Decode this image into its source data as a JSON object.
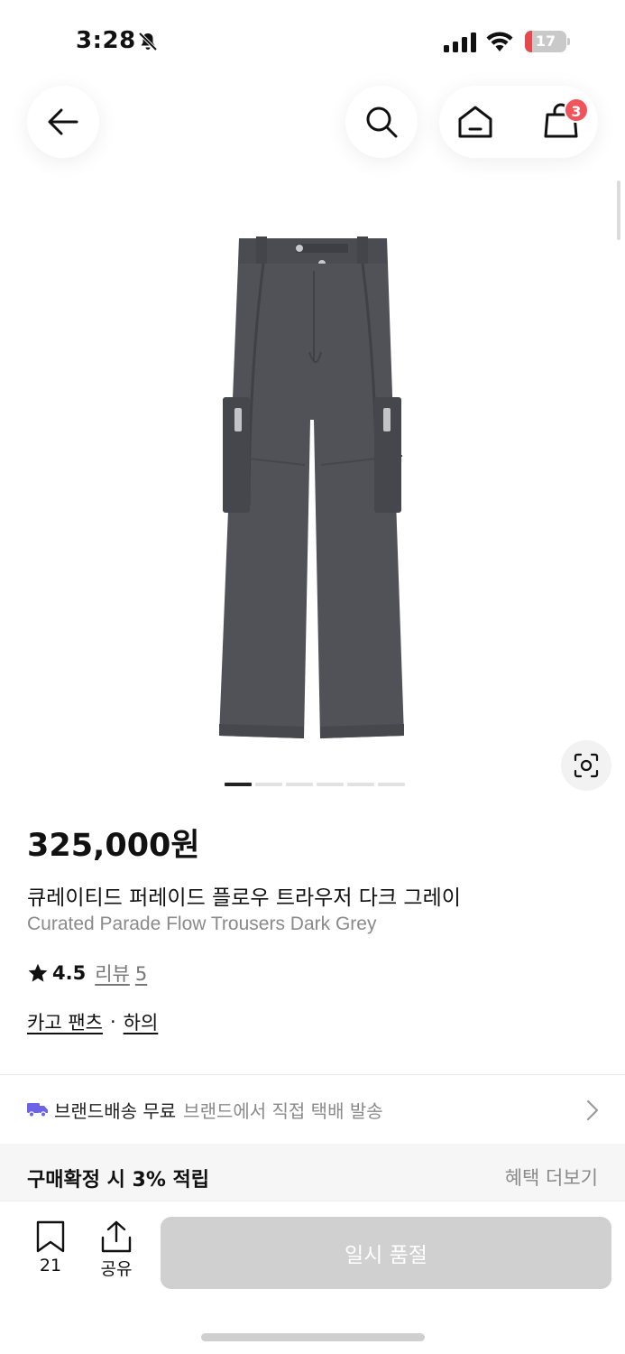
{
  "status_bar": {
    "time": "3:28",
    "battery_level": "17"
  },
  "nav": {
    "cart_count": "3"
  },
  "gallery": {
    "total_images": 6,
    "active_index": 0
  },
  "product": {
    "price": "325,000원",
    "name_ko": "큐레이티드 퍼레이드 플로우 트라우저 다크 그레이",
    "name_en": "Curated Parade Flow Trousers Dark Grey",
    "rating": "4.5",
    "review_label": "리뷰",
    "review_count": "5",
    "category_primary": "카고 팬츠",
    "category_separator": "·",
    "category_secondary": "하의"
  },
  "shipping": {
    "label": "브랜드배송 무료",
    "detail": "브랜드에서 직접 택배 발송"
  },
  "benefit": {
    "text": "구매확정 시 3% 적립",
    "more_label": "혜택 더보기"
  },
  "bottom_bar": {
    "bookmark_count": "21",
    "share_label": "공유",
    "soldout_label": "일시 품절"
  },
  "colors": {
    "badge": "#f2545b",
    "shipping_icon": "#6c63e8",
    "soldout_bg": "#d0d0d0"
  }
}
